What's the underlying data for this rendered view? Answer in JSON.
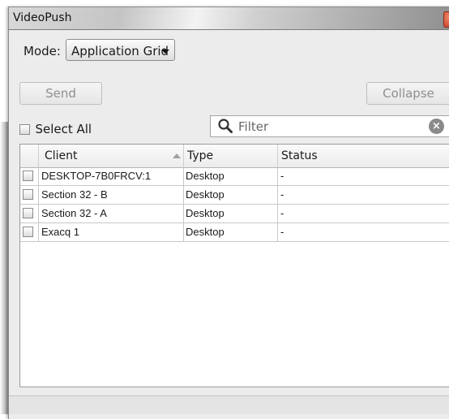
{
  "window": {
    "title": "VideoPush",
    "close_glyph": "×"
  },
  "mode": {
    "label": "Mode:",
    "selected": "Application Grid"
  },
  "buttons": {
    "send": "Send",
    "collapse": "Collapse"
  },
  "select_all": {
    "label": "Select All",
    "checked": false
  },
  "filter": {
    "placeholder": "Filter",
    "value": "",
    "clear_glyph": "×"
  },
  "grid": {
    "columns": [
      "Client",
      "Type",
      "Status"
    ],
    "sort": {
      "column": "Client",
      "direction": "ascending"
    },
    "rows": [
      {
        "client": "DESKTOP-7B0FRCV:1",
        "type": "Desktop",
        "status": "-",
        "checked": false
      },
      {
        "client": "Section 32 - B",
        "type": "Desktop",
        "status": "-",
        "checked": false
      },
      {
        "client": "Section 32 - A",
        "type": "Desktop",
        "status": "-",
        "checked": false
      },
      {
        "client": "Exacq 1",
        "type": "Desktop",
        "status": "-",
        "checked": false
      }
    ]
  },
  "icons": {
    "search": "search-icon",
    "clear": "clear-icon",
    "close": "close-icon",
    "dropdown": "chevron-down-icon",
    "sort": "sort-ascending-icon"
  },
  "colors": {
    "close_button": "#c63a1f",
    "disabled_text": "#8f8f8f",
    "window_bg": "#ececec"
  }
}
